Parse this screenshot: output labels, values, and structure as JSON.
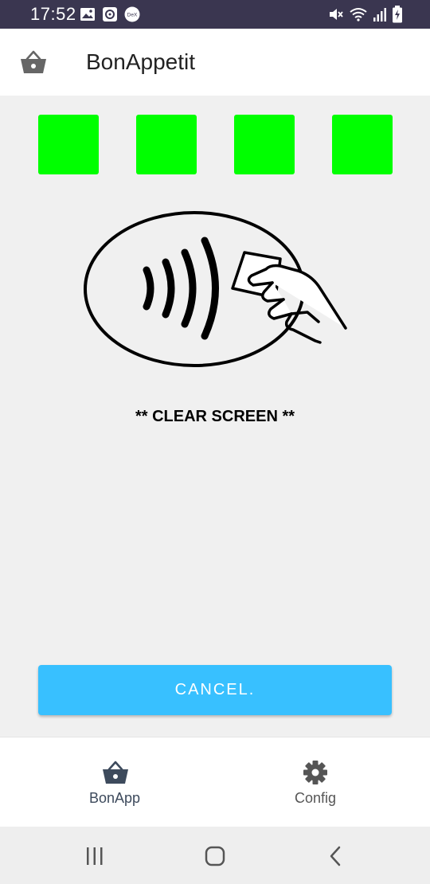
{
  "status_bar": {
    "time": "17:52",
    "left_icons": [
      "image-icon",
      "clock-app-icon",
      "dex-icon"
    ],
    "dex_label": "DeX",
    "right_icons": [
      "mute-icon",
      "wifi-icon",
      "signal-icon",
      "battery-charging-icon"
    ]
  },
  "app_bar": {
    "title": "BonAppetit",
    "icon": "basket-icon"
  },
  "indicators": {
    "count": 4,
    "color": "#00ff00"
  },
  "illustration": {
    "icon": "contactless-payment-icon"
  },
  "message": "** CLEAR SCREEN **",
  "cancel_button": {
    "label": "CANCEL.",
    "color": "#38c0ff"
  },
  "bottom_nav": {
    "items": [
      {
        "label": "BonApp",
        "icon": "basket-icon",
        "active": true,
        "color": "#3d4a5c"
      },
      {
        "label": "Config",
        "icon": "gear-icon",
        "active": false,
        "color": "#555555"
      }
    ]
  },
  "system_nav": {
    "buttons": [
      "recents-icon",
      "home-icon",
      "back-icon"
    ]
  }
}
